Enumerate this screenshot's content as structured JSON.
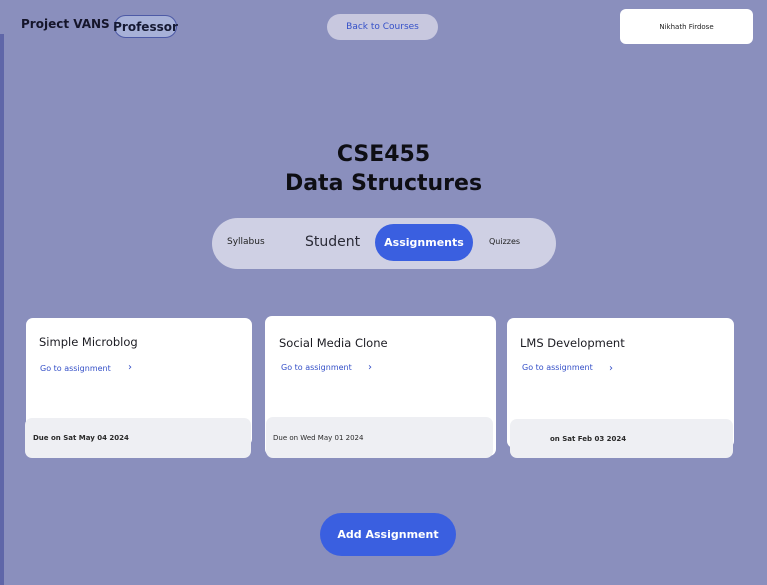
{
  "header": {
    "brand": "Project VANS",
    "role": "Professor",
    "back_label": "Back to Courses",
    "user_name": "Nikhath Firdose"
  },
  "course": {
    "code": "CSE455",
    "name": "Data Structures"
  },
  "tabs": [
    {
      "label": "Syllabus",
      "active": false
    },
    {
      "label": "Student",
      "active": false
    },
    {
      "label": "Assignments",
      "active": true
    },
    {
      "label": "Quizzes",
      "active": false
    }
  ],
  "assignments": [
    {
      "title": "Simple Microblog",
      "link": "Go to assignment",
      "chevron": "›",
      "due": "Due on Sat May 04 2024"
    },
    {
      "title": "Social Media Clone",
      "link": "Go to assignment",
      "chevron": "›",
      "due": "Due on Wed May 01 2024"
    },
    {
      "title": "LMS Development",
      "link": "Go to assignment",
      "chevron": "›",
      "due": "on Sat Feb 03 2024"
    }
  ],
  "actions": {
    "add_label": "Add Assignment"
  },
  "colors": {
    "background": "#8a8fbd",
    "accent": "#3a5fe0",
    "card": "#ffffff"
  }
}
